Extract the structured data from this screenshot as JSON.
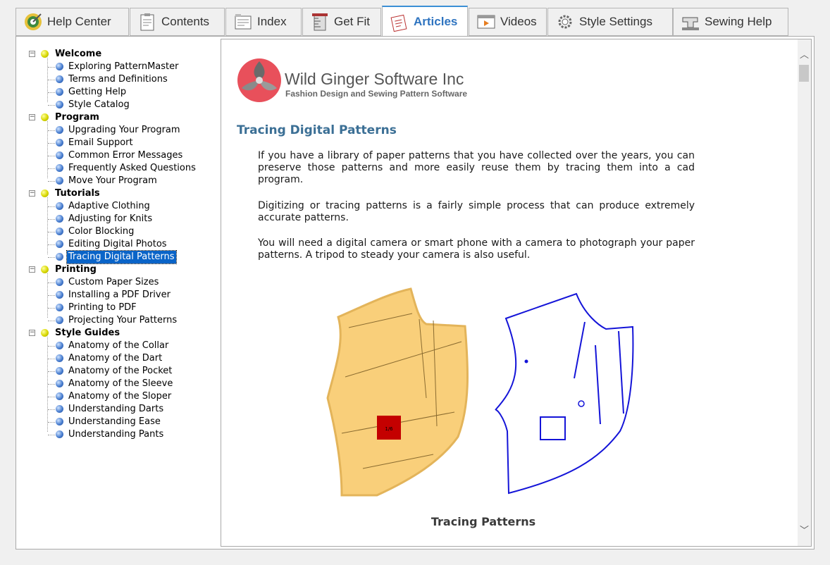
{
  "tabs": [
    {
      "label": "Help Center",
      "icon": "target-icon"
    },
    {
      "label": "Contents",
      "icon": "clipboard-icon"
    },
    {
      "label": "Index",
      "icon": "index-card-icon"
    },
    {
      "label": "Get Fit",
      "icon": "tape-measure-icon"
    },
    {
      "label": "Articles",
      "icon": "articles-icon",
      "active": true
    },
    {
      "label": "Videos",
      "icon": "video-icon"
    },
    {
      "label": "Style Settings",
      "icon": "gear-icon"
    },
    {
      "label": "Sewing Help",
      "icon": "sewing-machine-icon"
    }
  ],
  "tree": [
    {
      "label": "Welcome",
      "items": [
        "Exploring PatternMaster",
        "Terms and Definitions",
        "Getting Help",
        "Style Catalog"
      ]
    },
    {
      "label": "Program",
      "items": [
        "Upgrading Your Program",
        "Email Support",
        "Common Error Messages",
        "Frequently Asked Questions",
        "Move Your Program"
      ]
    },
    {
      "label": "Tutorials",
      "items": [
        "Adaptive Clothing",
        "Adjusting for Knits",
        "Color Blocking",
        "Editing Digital Photos",
        "Tracing Digital Patterns"
      ]
    },
    {
      "label": "Printing",
      "items": [
        "Custom Paper Sizes",
        "Installing a PDF Driver",
        "Printing to PDF",
        "Projecting Your Patterns"
      ]
    },
    {
      "label": "Style Guides",
      "items": [
        "Anatomy of the Collar",
        "Anatomy of the Dart",
        "Anatomy of the Pocket",
        "Anatomy of the Sleeve",
        "Anatomy of the Sloper",
        "Understanding Darts",
        "Understanding Ease",
        "Understanding Pants"
      ]
    }
  ],
  "selected_item": "Tracing Digital Patterns",
  "article": {
    "company": "Wild Ginger Software Inc",
    "tagline": "Fashion Design and Sewing Pattern Software",
    "title": "Tracing Digital Patterns",
    "paragraphs": [
      "If you have a library of paper patterns that you have collected over the years, you can preserve those patterns and more easily reuse them by tracing them into a cad program.",
      "Digitizing or tracing patterns is a fairly simple process that can produce extremely accurate patterns.",
      "You will need a digital camera or smart phone with a camera to photograph your paper patterns. A tripod to steady your camera is also useful."
    ],
    "caption": "Tracing Patterns",
    "photo_label": "1/6"
  },
  "colors": {
    "accent": "#3b8fd6",
    "heading": "#3b6f95",
    "pattern_fill": "#f9cf7a",
    "trace": "#1414d8",
    "logo_red": "#e8505b"
  }
}
